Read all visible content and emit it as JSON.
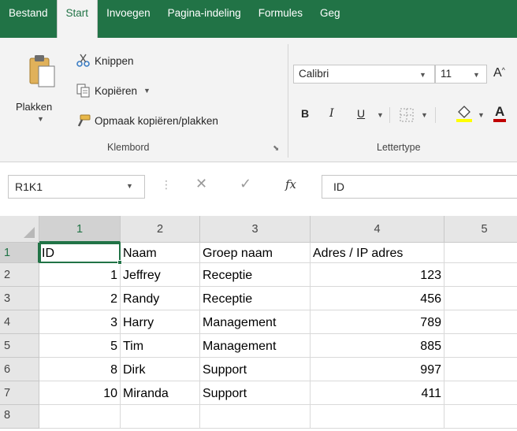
{
  "ribbon_tabs": [
    "Bestand",
    "Start",
    "Invoegen",
    "Pagina-indeling",
    "Formules",
    "Geg"
  ],
  "active_tab": "Start",
  "clipboard": {
    "paste_label": "Plakken",
    "cut_label": "Knippen",
    "copy_label": "Kopiëren",
    "format_painter_label": "Opmaak kopiëren/plakken",
    "group_label": "Klembord"
  },
  "font": {
    "name": "Calibri",
    "size": "11",
    "grow_label": "A",
    "bold": "B",
    "italic": "I",
    "underline": "U",
    "color_label": "A",
    "group_label": "Lettertype"
  },
  "formula_bar": {
    "name_box": "R1K1",
    "fx": "fx",
    "content": "ID"
  },
  "columns": [
    "1",
    "2",
    "3",
    "4",
    "5"
  ],
  "rows": [
    [
      "ID",
      "Naam",
      "Groep naam",
      "Adres / IP adres",
      ""
    ],
    [
      "1",
      "Jeffrey",
      "Receptie",
      "123",
      ""
    ],
    [
      "2",
      "Randy",
      "Receptie",
      "456",
      ""
    ],
    [
      "3",
      "Harry",
      "Management",
      "789",
      ""
    ],
    [
      "5",
      "Tim",
      "Management",
      "885",
      ""
    ],
    [
      "8",
      "Dirk",
      "Support",
      "997",
      ""
    ],
    [
      "10",
      "Miranda",
      "Support",
      "411",
      ""
    ]
  ],
  "row_numbers": [
    "1",
    "2",
    "3",
    "4",
    "5",
    "6",
    "7",
    "8"
  ],
  "colors": {
    "excel_green": "#217346",
    "fill_yellow": "#ffff00",
    "font_red": "#c00000"
  }
}
